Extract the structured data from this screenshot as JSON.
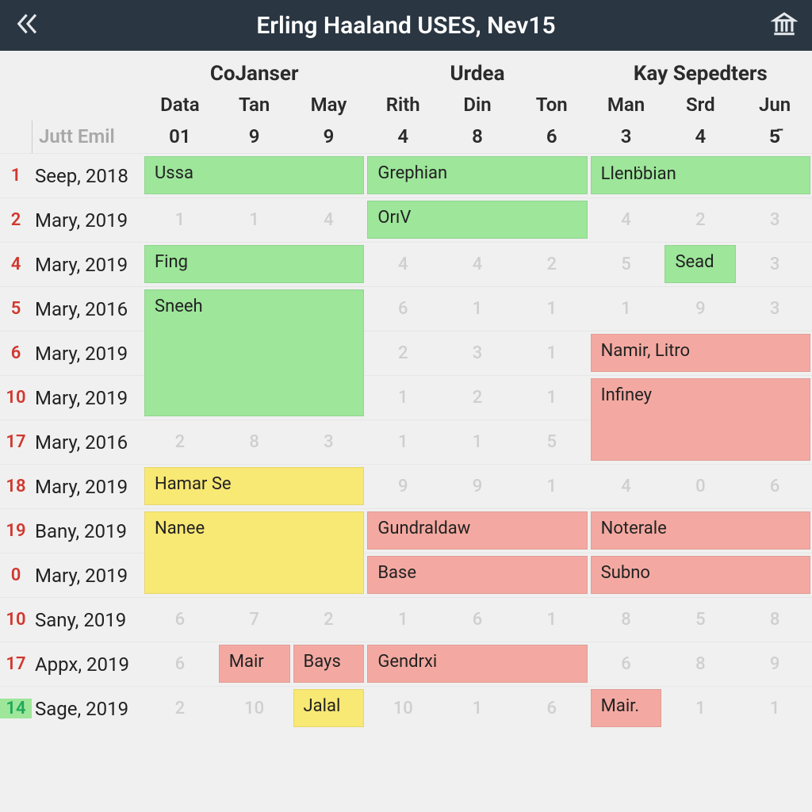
{
  "header": {
    "title": "Erling Haaland USES, Nev15",
    "back_icon": "chevrons-left-icon",
    "right_icon": "bank-icon"
  },
  "column_groups": [
    {
      "label": "CoJanser",
      "span": 3
    },
    {
      "label": "Urdea",
      "span": 3
    },
    {
      "label": "Kay Sepedters",
      "span": 3
    }
  ],
  "columns": [
    {
      "label": "Data",
      "num": "01"
    },
    {
      "label": "Tan",
      "num": "9"
    },
    {
      "label": "May",
      "num": "9"
    },
    {
      "label": "Rith",
      "num": "4"
    },
    {
      "label": "Din",
      "num": "8"
    },
    {
      "label": "Ton",
      "num": "6"
    },
    {
      "label": "Man",
      "num": "3"
    },
    {
      "label": "Srd",
      "num": "4"
    },
    {
      "label": "Jun",
      "num": "5̄"
    }
  ],
  "row_header_label": "Jutt Emil",
  "rows": [
    {
      "idx": "1",
      "label": "Seep, 2018",
      "bg": [
        "",
        "",
        "",
        "",
        "",
        "",
        "",
        "",
        ""
      ]
    },
    {
      "idx": "2",
      "label": "Mary, 2019",
      "bg": [
        "1",
        "1",
        "4",
        "",
        "",
        "",
        "4",
        "2",
        "3"
      ]
    },
    {
      "idx": "4",
      "label": "Mary, 2019",
      "bg": [
        "",
        "",
        "",
        "4",
        "4",
        "2",
        "5",
        "",
        "3"
      ]
    },
    {
      "idx": "5",
      "label": "Mary, 2016",
      "bg": [
        "",
        "",
        "",
        "6",
        "1",
        "1",
        "1",
        "9",
        "3"
      ]
    },
    {
      "idx": "6",
      "label": "Mary, 2019",
      "bg": [
        "",
        "",
        "",
        "2",
        "3",
        "1",
        "",
        "",
        ""
      ]
    },
    {
      "idx": "10",
      "label": "Mary, 2019",
      "bg": [
        "",
        "",
        "",
        "1",
        "2",
        "1",
        "",
        "",
        ""
      ]
    },
    {
      "idx": "17",
      "label": "Mary, 2016",
      "bg": [
        "2",
        "8",
        "3",
        "1",
        "1",
        "5",
        "",
        "",
        ""
      ]
    },
    {
      "idx": "18",
      "label": "Mary, 2019",
      "bg": [
        "",
        "",
        "",
        "9",
        "9",
        "1",
        "4",
        "0",
        "6"
      ]
    },
    {
      "idx": "19",
      "label": "Bany, 2019",
      "bg": [
        "",
        "",
        "",
        "",
        "",
        "",
        "",
        "",
        ""
      ]
    },
    {
      "idx": "0",
      "label": "Mary, 2019",
      "bg": [
        "",
        "",
        "",
        "",
        "",
        "",
        "",
        "",
        ""
      ]
    },
    {
      "idx": "10",
      "label": "Sany, 2019",
      "bg": [
        "6",
        "7",
        "2",
        "1",
        "6",
        "1",
        "8",
        "5",
        "8"
      ]
    },
    {
      "idx": "17",
      "label": "Appx, 2019",
      "bg": [
        "6",
        "",
        "",
        "",
        "",
        "",
        "6",
        "8",
        "9"
      ]
    },
    {
      "idx": "14",
      "label": "Sage, 2019",
      "bg": [
        "2",
        "10",
        "",
        "10",
        "1",
        "6",
        "",
        "1",
        "1"
      ],
      "green_idx": true
    }
  ],
  "blocks": [
    {
      "text": "Ussa",
      "color": "green",
      "row": 0,
      "row_span": 1,
      "col": 0,
      "col_span": 3
    },
    {
      "text": "Grephian",
      "color": "green",
      "row": 0,
      "row_span": 1,
      "col": 3,
      "col_span": 3
    },
    {
      "text": "Llenḃbian",
      "color": "green",
      "row": 0,
      "row_span": 1,
      "col": 6,
      "col_span": 3
    },
    {
      "text": "OrıV",
      "color": "green",
      "row": 1,
      "row_span": 1,
      "col": 3,
      "col_span": 3
    },
    {
      "text": "Fing",
      "color": "green",
      "row": 2,
      "row_span": 1,
      "col": 0,
      "col_span": 3
    },
    {
      "text": "Sead",
      "color": "green",
      "row": 2,
      "row_span": 1,
      "col": 7,
      "col_span": 1
    },
    {
      "text": "Sneeh",
      "color": "green",
      "row": 3,
      "row_span": 3,
      "col": 0,
      "col_span": 3
    },
    {
      "text": "Namir, Litro",
      "color": "red",
      "row": 4,
      "row_span": 1,
      "col": 6,
      "col_span": 3,
      "stack_group": "A"
    },
    {
      "text": "Infiney",
      "color": "red",
      "row": 5,
      "row_span": 2,
      "col": 6,
      "col_span": 3,
      "stack_group": "A"
    },
    {
      "text": "Hamar Se",
      "color": "yellow",
      "row": 7,
      "row_span": 1,
      "col": 0,
      "col_span": 3,
      "stack_group": "B"
    },
    {
      "text": "Nanee",
      "color": "yellow",
      "row": 8,
      "row_span": 2,
      "col": 0,
      "col_span": 3,
      "stack_group": "B"
    },
    {
      "text": "Gundraldaw",
      "color": "red",
      "row": 8,
      "row_span": 1,
      "col": 3,
      "col_span": 3,
      "stack_group": "C"
    },
    {
      "text": "Base",
      "color": "red",
      "row": 9,
      "row_span": 1,
      "col": 3,
      "col_span": 3,
      "stack_group": "C"
    },
    {
      "text": "Noterale",
      "color": "red",
      "row": 8,
      "row_span": 1,
      "col": 6,
      "col_span": 3,
      "stack_group": "D"
    },
    {
      "text": "Subno",
      "color": "red",
      "row": 9,
      "row_span": 1,
      "col": 6,
      "col_span": 3,
      "stack_group": "D"
    },
    {
      "text": "Mair",
      "color": "red",
      "row": 11,
      "row_span": 1,
      "col": 1,
      "col_span": 1
    },
    {
      "text": "Bays",
      "color": "red",
      "row": 11,
      "row_span": 1,
      "col": 2,
      "col_span": 1
    },
    {
      "text": "Gendrxi",
      "color": "red",
      "row": 11,
      "row_span": 1,
      "col": 3,
      "col_span": 3
    },
    {
      "text": "Jalal",
      "color": "yellow",
      "row": 12,
      "row_span": 1,
      "col": 2,
      "col_span": 1
    },
    {
      "text": "Mair.",
      "color": "red",
      "row": 12,
      "row_span": 1,
      "col": 6,
      "col_span": 1
    }
  ]
}
